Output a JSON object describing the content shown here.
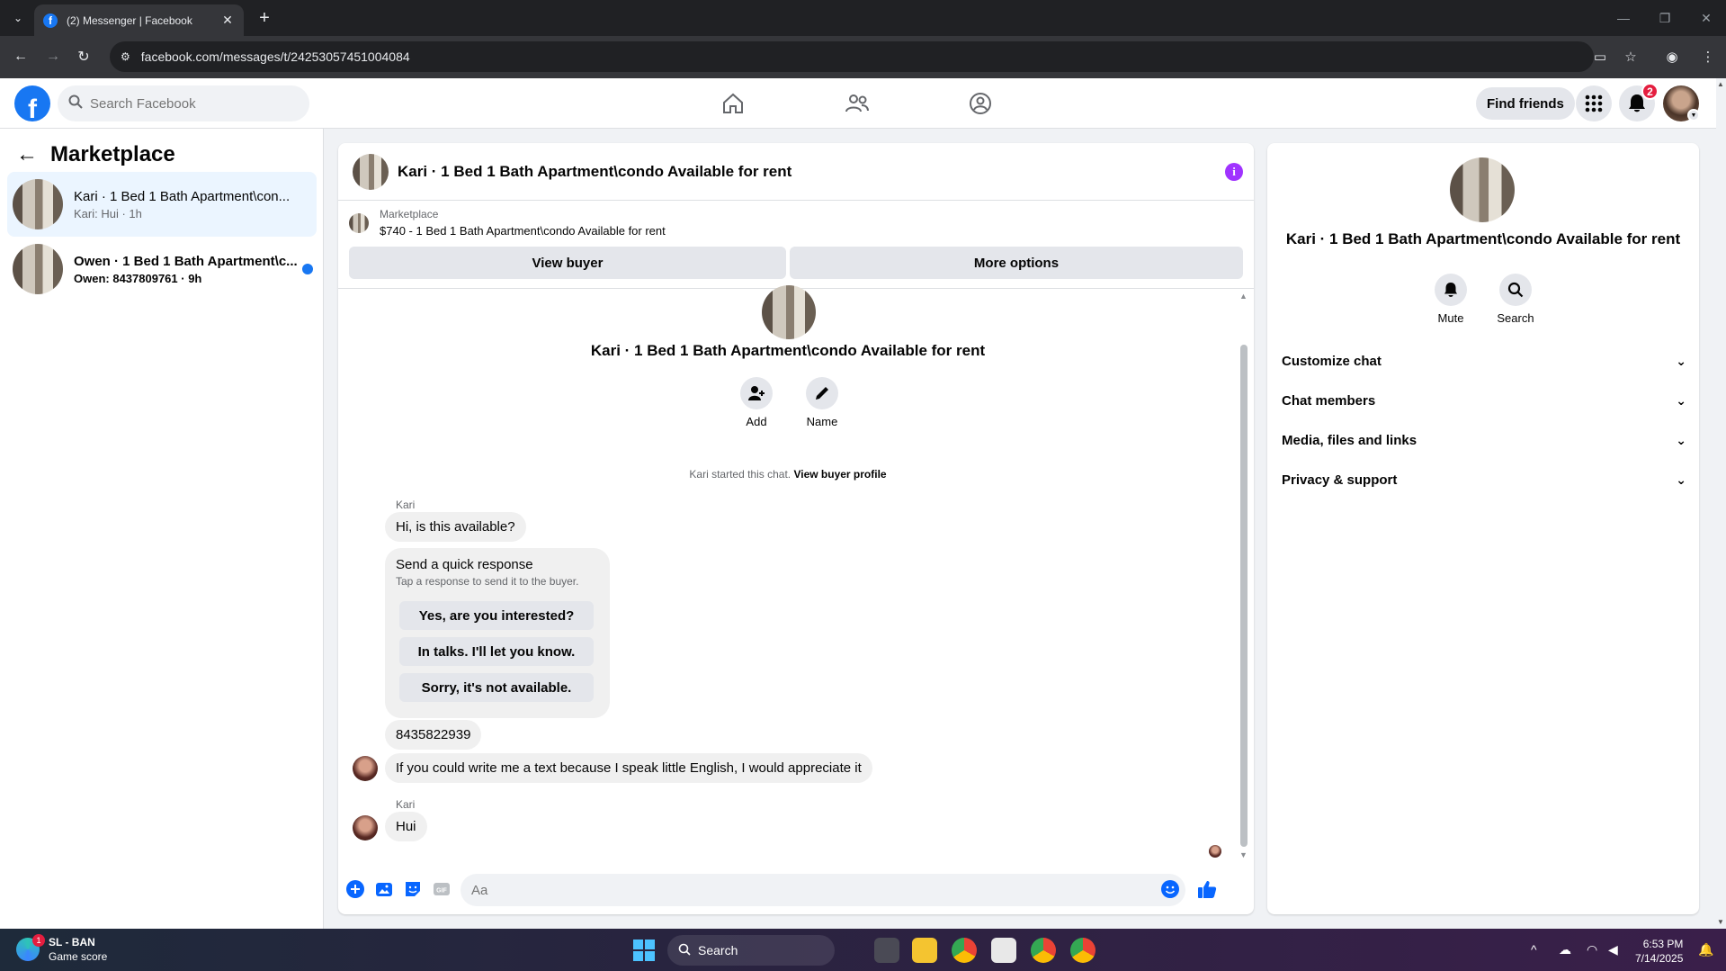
{
  "browser": {
    "tab_title": "(2) Messenger | Facebook",
    "url": "facebook.com/messages/t/24253057451004084"
  },
  "fb_header": {
    "search_placeholder": "Search Facebook",
    "find_friends": "Find friends",
    "notifications_count": "2"
  },
  "sidebar": {
    "title": "Marketplace",
    "conversations": [
      {
        "name": "Kari · 1 Bed 1 Bath Apartment\\con...",
        "preview": "Kari: Hui · 1h",
        "active": true,
        "unread": false
      },
      {
        "name": "Owen · 1 Bed 1 Bath Apartment\\c...",
        "preview": "Owen: 8437809761 · 9h",
        "active": false,
        "unread": true
      }
    ]
  },
  "chat": {
    "header_title": "Kari · 1 Bed 1 Bath Apartment\\condo Available for rent",
    "marketplace_label": "Marketplace",
    "listing": "$740 - 1 Bed 1 Bath Apartment\\condo Available for rent",
    "view_buyer": "View buyer",
    "more_options": "More options",
    "intro_title": "Kari · 1 Bed 1 Bath Apartment\\condo Available for rent",
    "add_label": "Add",
    "name_label": "Name",
    "started_text": "Kari started this chat.",
    "view_buyer_profile": "View buyer profile",
    "messages": {
      "sender1": "Kari",
      "msg1": "Hi, is this available?",
      "quick_title": "Send a quick response",
      "quick_sub": "Tap a response to send it to the buyer.",
      "quick_responses": [
        "Yes, are you interested?",
        "In talks. I'll let you know.",
        "Sorry, it's not available."
      ],
      "msg2": "8435822939",
      "msg3": "If you could write me a text because I speak little English, I would appreciate it",
      "sender2": "Kari",
      "msg4": "Hui"
    },
    "composer_placeholder": "Aa"
  },
  "details": {
    "title": "Kari · 1 Bed 1 Bath Apartment\\condo Available for rent",
    "mute": "Mute",
    "search": "Search",
    "sections": [
      "Customize chat",
      "Chat members",
      "Media, files and links",
      "Privacy & support"
    ]
  },
  "taskbar": {
    "score_title": "SL - BAN",
    "score_sub": "Game score",
    "score_badge": "1",
    "search": "Search",
    "time": "6:53 PM",
    "date": "7/14/2025"
  },
  "colors": {
    "fb_blue": "#1877f2",
    "messenger_purple": "#a033ff",
    "unread_dot": "#1877f2"
  }
}
